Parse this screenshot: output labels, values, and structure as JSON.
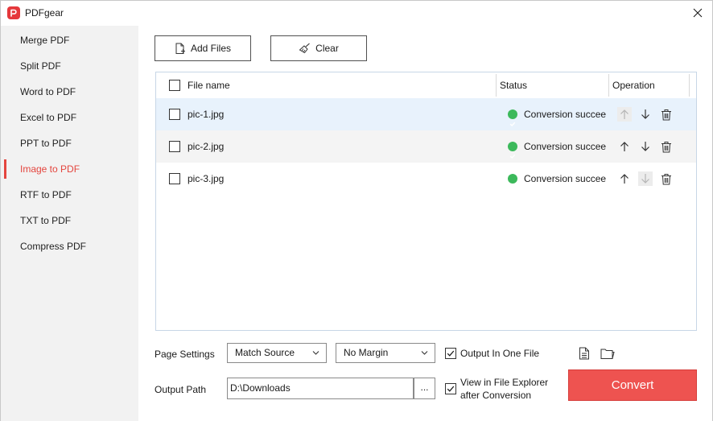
{
  "app": {
    "title": "PDFgear"
  },
  "sidebar": {
    "items": [
      {
        "label": "Merge PDF"
      },
      {
        "label": "Split PDF"
      },
      {
        "label": "Word to PDF"
      },
      {
        "label": "Excel to PDF"
      },
      {
        "label": "PPT to PDF"
      },
      {
        "label": "Image to PDF",
        "active": true
      },
      {
        "label": "RTF to PDF"
      },
      {
        "label": "TXT to PDF"
      },
      {
        "label": "Compress PDF"
      }
    ]
  },
  "toolbar": {
    "add_label": "Add Files",
    "clear_label": "Clear"
  },
  "table": {
    "columns": {
      "file": "File name",
      "status": "Status",
      "operation": "Operation"
    },
    "rows": [
      {
        "file": "pic-1.jpg",
        "status": "Conversion succeeded",
        "up_disabled": true,
        "down_disabled": false
      },
      {
        "file": "pic-2.jpg",
        "status": "Conversion succeeded",
        "up_disabled": false,
        "down_disabled": false
      },
      {
        "file": "pic-3.jpg",
        "status": "Conversion succeeded",
        "up_disabled": false,
        "down_disabled": true
      }
    ]
  },
  "settings": {
    "page_settings_label": "Page Settings",
    "page_size": "Match Source",
    "margin": "No Margin",
    "output_one_file_label": "Output In One File",
    "output_one_file": true,
    "output_path_label": "Output Path",
    "output_path": "D:\\Downloads",
    "browse_label": "...",
    "view_in_explorer_line1": "View in File Explorer",
    "view_in_explorer_line2": "after Conversion",
    "view_in_explorer": true
  },
  "convert_label": "Convert",
  "colors": {
    "accent": "#e4453e",
    "convert": "#ee5350",
    "success": "#3cb95b"
  }
}
